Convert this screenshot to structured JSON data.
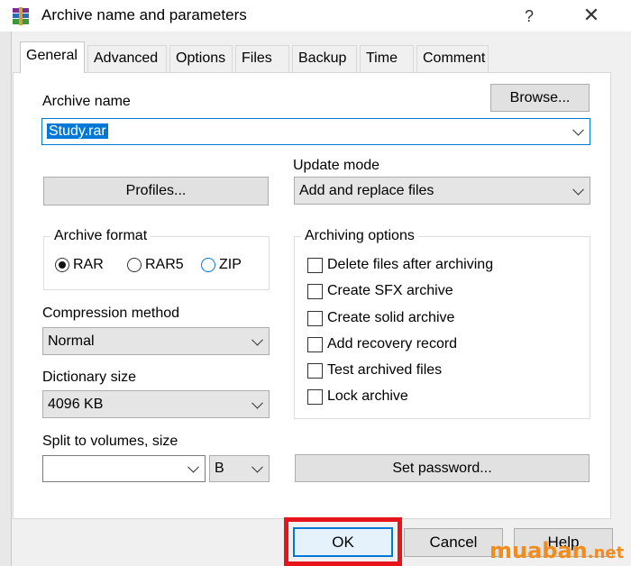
{
  "window": {
    "title": "Archive name and parameters",
    "help_label": "?",
    "close_label": "✕",
    "icon": "winrar-books-icon"
  },
  "tabs": [
    {
      "label": "General"
    },
    {
      "label": "Advanced"
    },
    {
      "label": "Options"
    },
    {
      "label": "Files"
    },
    {
      "label": "Backup"
    },
    {
      "label": "Time"
    },
    {
      "label": "Comment"
    }
  ],
  "archive_name": {
    "label": "Archive name",
    "value": "Study.rar",
    "browse_label": "Browse..."
  },
  "profiles_label": "Profiles...",
  "update_mode": {
    "label": "Update mode",
    "value": "Add and replace files"
  },
  "archive_format": {
    "title": "Archive format",
    "options": [
      {
        "label": "RAR",
        "selected": true
      },
      {
        "label": "RAR5",
        "selected": false
      },
      {
        "label": "ZIP",
        "selected": false
      }
    ]
  },
  "compression": {
    "label": "Compression method",
    "value": "Normal"
  },
  "dictionary": {
    "label": "Dictionary size",
    "value": "4096 KB"
  },
  "split": {
    "label": "Split to volumes, size",
    "value": "",
    "unit": "B"
  },
  "archiving_options": {
    "title": "Archiving options",
    "items": [
      {
        "label": "Delete files after archiving",
        "checked": false
      },
      {
        "label": "Create SFX archive",
        "checked": false
      },
      {
        "label": "Create solid archive",
        "checked": false
      },
      {
        "label": "Add recovery record",
        "checked": false
      },
      {
        "label": "Test archived files",
        "checked": false
      },
      {
        "label": "Lock archive",
        "checked": false
      }
    ]
  },
  "set_password_label": "Set password...",
  "buttons": {
    "ok": "OK",
    "cancel": "Cancel",
    "help": "Help"
  },
  "watermark": {
    "brand": "muaban",
    "suffix": ".net"
  },
  "colors": {
    "accent": "#0078d7",
    "highlight": "#e8141c",
    "watermark": "#f28c1c"
  }
}
